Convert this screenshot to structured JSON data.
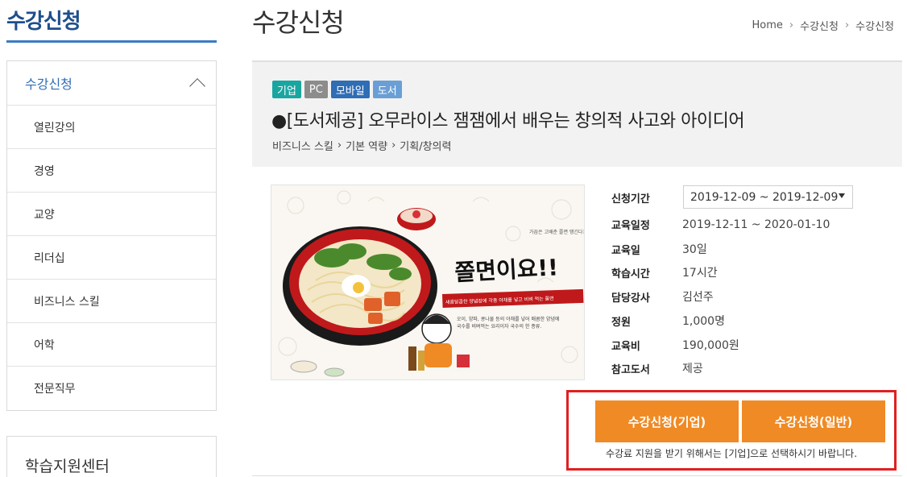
{
  "sidebar": {
    "title": "수강신청",
    "menu_header": "수강신청",
    "items": [
      "열린강의",
      "경영",
      "교양",
      "리더십",
      "비즈니스 스킬",
      "어학",
      "전문직무"
    ],
    "support_title": "학습지원센터"
  },
  "header": {
    "page_title": "수강신청",
    "breadcrumb": [
      "Home",
      "수강신청",
      "수강신청"
    ]
  },
  "course": {
    "tags": [
      {
        "label": "기업",
        "color": "#1aa6a0"
      },
      {
        "label": "PC",
        "color": "#8c8c8c"
      },
      {
        "label": "모바일",
        "color": "#2f6db5"
      },
      {
        "label": "도서",
        "color": "#6a9fd6"
      }
    ],
    "title": "●[도서제공] 오무라이스 잼잼에서 배우는 창의적 사고와 아이디어",
    "category": [
      "비즈니스 스킬",
      "기본 역량",
      "기획/창의력"
    ],
    "image_text": {
      "headline": "쫄면이요!!",
      "banner": "새콤달콤한 양념장에 각종 야채를 넣고 비벼 먹는 쫄면",
      "caption_1": "오이, 양파, 콩나물 등의 야채를 넣어 매콤한 양념에",
      "caption_2": "국수를 비벼먹는 요리이자 국수의 한 종류.",
      "aside": "가끔은 고배춘 쫄면 땡긴다?"
    }
  },
  "info": {
    "period_label": "신청기간",
    "period_value": "2019-12-09 ~ 2019-12-09",
    "rows": [
      {
        "label": "교육일정",
        "value": "2019-12-11 ~ 2020-01-10"
      },
      {
        "label": "교육일",
        "value": "30일"
      },
      {
        "label": "학습시간",
        "value": "17시간"
      },
      {
        "label": "담당강사",
        "value": "김선주"
      },
      {
        "label": "정원",
        "value": "1,000명"
      },
      {
        "label": "교육비",
        "value": "190,000원"
      },
      {
        "label": "참고도서",
        "value": "제공"
      }
    ]
  },
  "apply": {
    "btn_corporate": "수강신청(기업)",
    "btn_general": "수강신청(일반)",
    "note": "수강료 지원을 받기 위해서는 [기업]으로 선택하시기 바랍니다."
  },
  "colors": {
    "accent": "#f08a24",
    "highlight_border": "#e02020",
    "brand_blue": "#1f4e8c"
  }
}
